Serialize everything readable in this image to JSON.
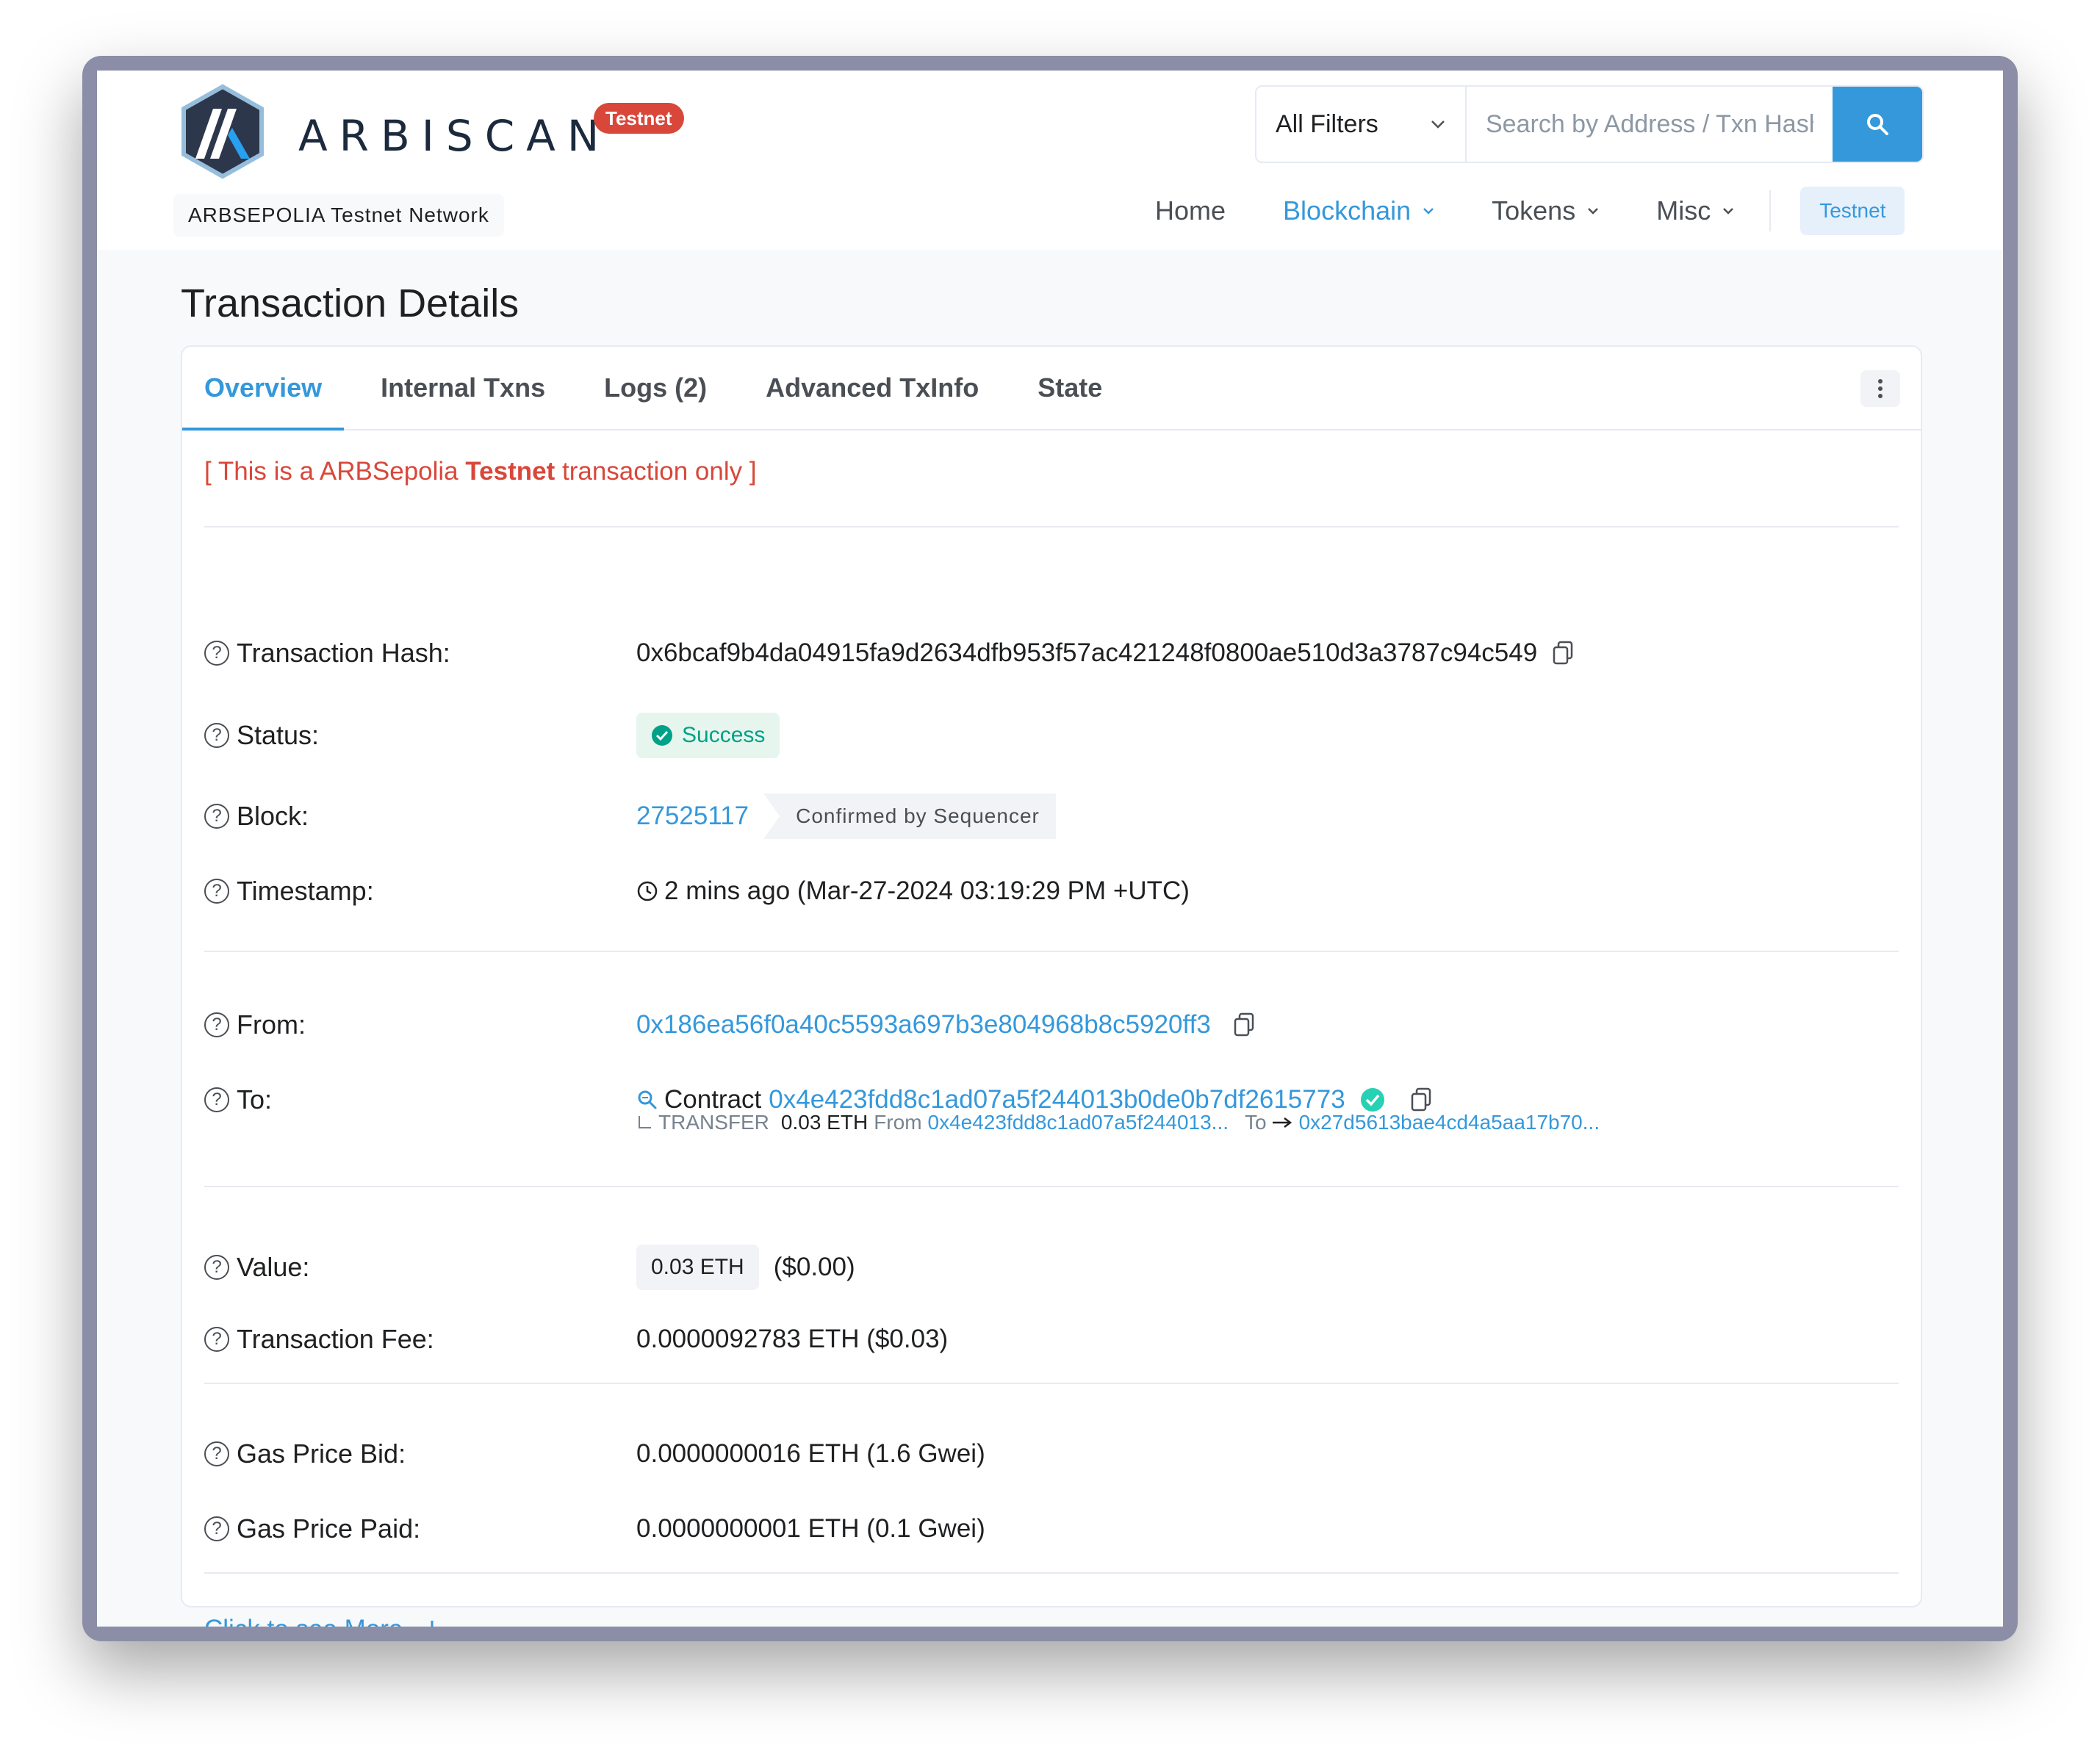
{
  "brand": {
    "name": "ARBISCAN",
    "badge": "Testnet",
    "network": "ARBSEPOLIA Testnet Network"
  },
  "search": {
    "filter_label": "All Filters",
    "placeholder": "Search by Address / Txn Hash"
  },
  "nav": {
    "home": "Home",
    "blockchain": "Blockchain",
    "tokens": "Tokens",
    "misc": "Misc",
    "testnet": "Testnet"
  },
  "page": {
    "title": "Transaction Details"
  },
  "tabs": {
    "overview": "Overview",
    "internal": "Internal Txns",
    "logs": "Logs (2)",
    "advanced": "Advanced TxInfo",
    "state": "State"
  },
  "notice": {
    "prefix": "[ This is a ARBSepolia ",
    "bold": "Testnet",
    "suffix": " transaction only ]"
  },
  "details": {
    "hash_label": "Transaction Hash:",
    "hash_value": "0x6bcaf9b4da04915fa9d2634dfb953f57ac421248f0800ae510d3a3787c94c549",
    "status_label": "Status:",
    "status_value": "Success",
    "block_label": "Block:",
    "block_value": "27525117",
    "block_badge": "Confirmed by Sequencer",
    "timestamp_label": "Timestamp:",
    "timestamp_value": "2 mins ago (Mar-27-2024 03:19:29 PM +UTC)",
    "from_label": "From:",
    "from_value": "0x186ea56f0a40c5593a697b3e804968b8c5920ff3",
    "to_label": "To:",
    "to_prefix": "Contract",
    "to_value": "0x4e423fdd8c1ad07a5f244013b0de0b7df2615773",
    "transfer_label": "TRANSFER",
    "transfer_amount": "0.03 ETH",
    "transfer_from_label": "From",
    "transfer_from": "0x4e423fdd8c1ad07a5f244013...",
    "transfer_to_label": "To",
    "transfer_to": "0x27d5613bae4cd4a5aa17b70...",
    "value_label": "Value:",
    "value_amount": "0.03 ETH",
    "value_usd": "($0.00)",
    "fee_label": "Transaction Fee:",
    "fee_value": "0.0000092783 ETH ($0.03)",
    "gas_bid_label": "Gas Price Bid:",
    "gas_bid_value": "0.0000000016 ETH (1.6 Gwei)",
    "gas_paid_label": "Gas Price Paid:",
    "gas_paid_value": "0.0000000001 ETH (0.1 Gwei)",
    "see_more": "Click to see More"
  },
  "colors": {
    "accent": "#3498db",
    "danger": "#d9473a",
    "success": "#00a186"
  }
}
